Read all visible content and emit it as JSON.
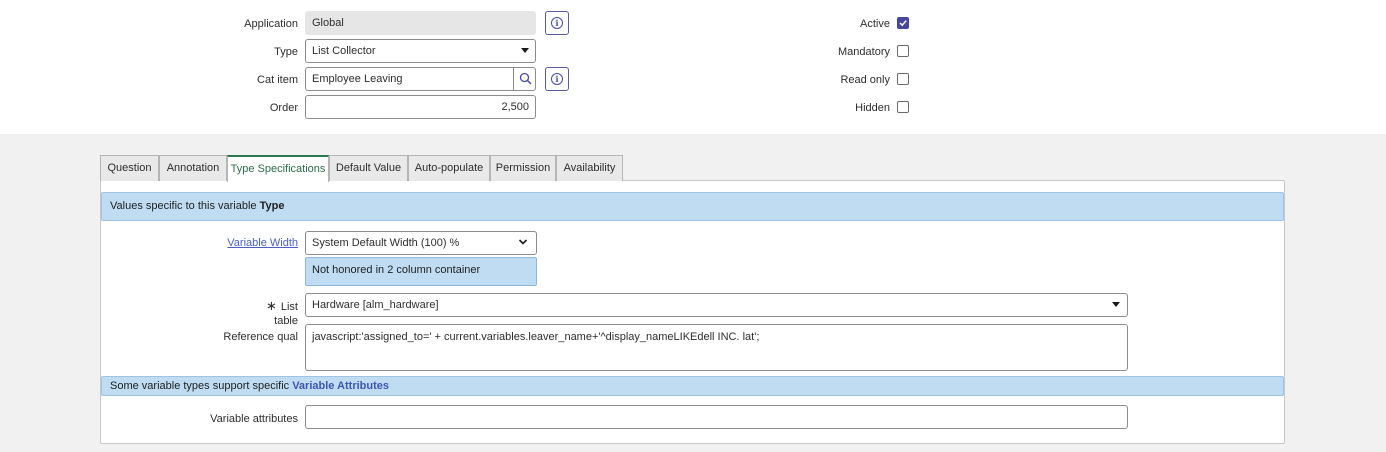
{
  "form": {
    "application": {
      "label": "Application",
      "value": "Global"
    },
    "type": {
      "label": "Type",
      "value": "List Collector"
    },
    "cat_item": {
      "label": "Cat item",
      "value": "Employee Leaving"
    },
    "order": {
      "label": "Order",
      "value": "2,500"
    }
  },
  "flags": {
    "active": {
      "label": "Active",
      "checked": true
    },
    "mandatory": {
      "label": "Mandatory",
      "checked": false
    },
    "read_only": {
      "label": "Read only",
      "checked": false
    },
    "hidden": {
      "label": "Hidden",
      "checked": false
    }
  },
  "tabs": [
    {
      "label": "Question"
    },
    {
      "label": "Annotation"
    },
    {
      "label": "Type Specifications",
      "active": true
    },
    {
      "label": "Default Value"
    },
    {
      "label": "Auto-populate"
    },
    {
      "label": "Permission"
    },
    {
      "label": "Availability"
    }
  ],
  "type_spec": {
    "banner_prefix": "Values specific to this variable ",
    "banner_bold": "Type",
    "variable_width": {
      "label": "Variable Width",
      "value": "System Default Width (100) %"
    },
    "width_note": "Not honored in 2 column container",
    "list_table": {
      "required_mark": "∗",
      "label": "List table",
      "value": "Hardware [alm_hardware]"
    },
    "reference_qual": {
      "label": "Reference qual",
      "value": "javascript:'assigned_to=' + current.variables.leaver_name+'^display_nameLIKEdell INC. lat';"
    },
    "attributes_banner_prefix": "Some variable types support specific ",
    "attributes_banner_link": "Variable Attributes",
    "variable_attributes": {
      "label": "Variable attributes",
      "value": ""
    }
  },
  "colors": {
    "accent": "#4646a0",
    "tab_active": "#2b7a4f",
    "banner": "#bfdcf2"
  }
}
